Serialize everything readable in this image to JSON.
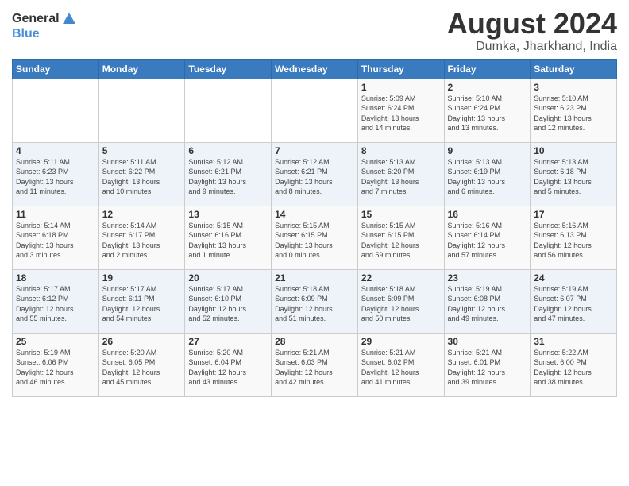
{
  "logo": {
    "general": "General",
    "blue": "Blue"
  },
  "title": "August 2024",
  "subtitle": "Dumka, Jharkhand, India",
  "days_header": [
    "Sunday",
    "Monday",
    "Tuesday",
    "Wednesday",
    "Thursday",
    "Friday",
    "Saturday"
  ],
  "weeks": [
    [
      {
        "day": "",
        "detail": ""
      },
      {
        "day": "",
        "detail": ""
      },
      {
        "day": "",
        "detail": ""
      },
      {
        "day": "",
        "detail": ""
      },
      {
        "day": "1",
        "detail": "Sunrise: 5:09 AM\nSunset: 6:24 PM\nDaylight: 13 hours\nand 14 minutes."
      },
      {
        "day": "2",
        "detail": "Sunrise: 5:10 AM\nSunset: 6:24 PM\nDaylight: 13 hours\nand 13 minutes."
      },
      {
        "day": "3",
        "detail": "Sunrise: 5:10 AM\nSunset: 6:23 PM\nDaylight: 13 hours\nand 12 minutes."
      }
    ],
    [
      {
        "day": "4",
        "detail": "Sunrise: 5:11 AM\nSunset: 6:23 PM\nDaylight: 13 hours\nand 11 minutes."
      },
      {
        "day": "5",
        "detail": "Sunrise: 5:11 AM\nSunset: 6:22 PM\nDaylight: 13 hours\nand 10 minutes."
      },
      {
        "day": "6",
        "detail": "Sunrise: 5:12 AM\nSunset: 6:21 PM\nDaylight: 13 hours\nand 9 minutes."
      },
      {
        "day": "7",
        "detail": "Sunrise: 5:12 AM\nSunset: 6:21 PM\nDaylight: 13 hours\nand 8 minutes."
      },
      {
        "day": "8",
        "detail": "Sunrise: 5:13 AM\nSunset: 6:20 PM\nDaylight: 13 hours\nand 7 minutes."
      },
      {
        "day": "9",
        "detail": "Sunrise: 5:13 AM\nSunset: 6:19 PM\nDaylight: 13 hours\nand 6 minutes."
      },
      {
        "day": "10",
        "detail": "Sunrise: 5:13 AM\nSunset: 6:18 PM\nDaylight: 13 hours\nand 5 minutes."
      }
    ],
    [
      {
        "day": "11",
        "detail": "Sunrise: 5:14 AM\nSunset: 6:18 PM\nDaylight: 13 hours\nand 3 minutes."
      },
      {
        "day": "12",
        "detail": "Sunrise: 5:14 AM\nSunset: 6:17 PM\nDaylight: 13 hours\nand 2 minutes."
      },
      {
        "day": "13",
        "detail": "Sunrise: 5:15 AM\nSunset: 6:16 PM\nDaylight: 13 hours\nand 1 minute."
      },
      {
        "day": "14",
        "detail": "Sunrise: 5:15 AM\nSunset: 6:15 PM\nDaylight: 13 hours\nand 0 minutes."
      },
      {
        "day": "15",
        "detail": "Sunrise: 5:15 AM\nSunset: 6:15 PM\nDaylight: 12 hours\nand 59 minutes."
      },
      {
        "day": "16",
        "detail": "Sunrise: 5:16 AM\nSunset: 6:14 PM\nDaylight: 12 hours\nand 57 minutes."
      },
      {
        "day": "17",
        "detail": "Sunrise: 5:16 AM\nSunset: 6:13 PM\nDaylight: 12 hours\nand 56 minutes."
      }
    ],
    [
      {
        "day": "18",
        "detail": "Sunrise: 5:17 AM\nSunset: 6:12 PM\nDaylight: 12 hours\nand 55 minutes."
      },
      {
        "day": "19",
        "detail": "Sunrise: 5:17 AM\nSunset: 6:11 PM\nDaylight: 12 hours\nand 54 minutes."
      },
      {
        "day": "20",
        "detail": "Sunrise: 5:17 AM\nSunset: 6:10 PM\nDaylight: 12 hours\nand 52 minutes."
      },
      {
        "day": "21",
        "detail": "Sunrise: 5:18 AM\nSunset: 6:09 PM\nDaylight: 12 hours\nand 51 minutes."
      },
      {
        "day": "22",
        "detail": "Sunrise: 5:18 AM\nSunset: 6:09 PM\nDaylight: 12 hours\nand 50 minutes."
      },
      {
        "day": "23",
        "detail": "Sunrise: 5:19 AM\nSunset: 6:08 PM\nDaylight: 12 hours\nand 49 minutes."
      },
      {
        "day": "24",
        "detail": "Sunrise: 5:19 AM\nSunset: 6:07 PM\nDaylight: 12 hours\nand 47 minutes."
      }
    ],
    [
      {
        "day": "25",
        "detail": "Sunrise: 5:19 AM\nSunset: 6:06 PM\nDaylight: 12 hours\nand 46 minutes."
      },
      {
        "day": "26",
        "detail": "Sunrise: 5:20 AM\nSunset: 6:05 PM\nDaylight: 12 hours\nand 45 minutes."
      },
      {
        "day": "27",
        "detail": "Sunrise: 5:20 AM\nSunset: 6:04 PM\nDaylight: 12 hours\nand 43 minutes."
      },
      {
        "day": "28",
        "detail": "Sunrise: 5:21 AM\nSunset: 6:03 PM\nDaylight: 12 hours\nand 42 minutes."
      },
      {
        "day": "29",
        "detail": "Sunrise: 5:21 AM\nSunset: 6:02 PM\nDaylight: 12 hours\nand 41 minutes."
      },
      {
        "day": "30",
        "detail": "Sunrise: 5:21 AM\nSunset: 6:01 PM\nDaylight: 12 hours\nand 39 minutes."
      },
      {
        "day": "31",
        "detail": "Sunrise: 5:22 AM\nSunset: 6:00 PM\nDaylight: 12 hours\nand 38 minutes."
      }
    ]
  ]
}
